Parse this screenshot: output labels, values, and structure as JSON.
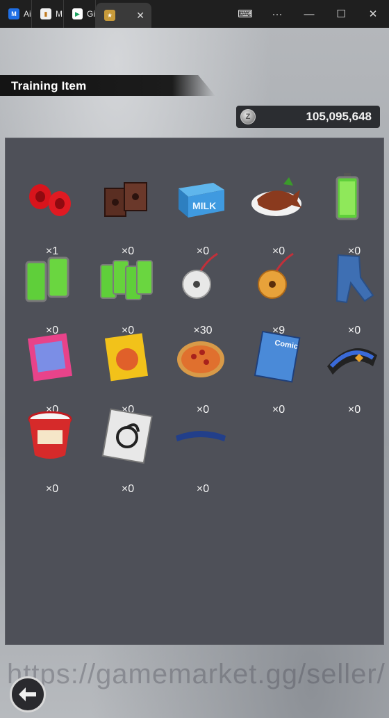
{
  "browser": {
    "tabs": [
      {
        "label": "Ai",
        "icon": "app-icon",
        "color": "#1f6fe5"
      },
      {
        "label": "M",
        "icon": "app-icon",
        "color": "#f1f1f1"
      },
      {
        "label": "Gi",
        "icon": "play-store-icon",
        "color": "#ffffff"
      },
      {
        "label": "",
        "icon": "game-icon",
        "color": "#c79a3a"
      }
    ],
    "close_glyph": "✕",
    "window": {
      "keyboard": "⌨",
      "more": "···",
      "minimize": "—",
      "maximize": "☐",
      "close": "✕"
    }
  },
  "header": {
    "title": "Training Item"
  },
  "currency": {
    "amount": "105,095,648",
    "icon": "zeni-coin-icon"
  },
  "items": [
    {
      "name": "red-weights",
      "count": "×1"
    },
    {
      "name": "brown-blocks",
      "count": "×0"
    },
    {
      "name": "milk-carton",
      "count": "×0"
    },
    {
      "name": "grilled-fish",
      "count": "×0"
    },
    {
      "name": "green-battery",
      "count": "×0"
    },
    {
      "name": "double-battery",
      "count": "×0"
    },
    {
      "name": "battery-pack",
      "count": "×0"
    },
    {
      "name": "silver-bell",
      "count": "×30"
    },
    {
      "name": "gold-bell",
      "count": "×9"
    },
    {
      "name": "blue-jeans",
      "count": "×0"
    },
    {
      "name": "pink-magazine",
      "count": "×0"
    },
    {
      "name": "game-box",
      "count": "×0"
    },
    {
      "name": "pizza",
      "count": "×0"
    },
    {
      "name": "comic-book",
      "count": "×0"
    },
    {
      "name": "blue-scarf",
      "count": "×0"
    },
    {
      "name": "cup-noodles",
      "count": "×0"
    },
    {
      "name": "capsule-card",
      "count": "×0"
    },
    {
      "name": "blue-band",
      "count": "×0"
    }
  ],
  "watermark": "https://gamemarket.gg/seller/",
  "back": {
    "icon": "back-arrow-icon"
  }
}
